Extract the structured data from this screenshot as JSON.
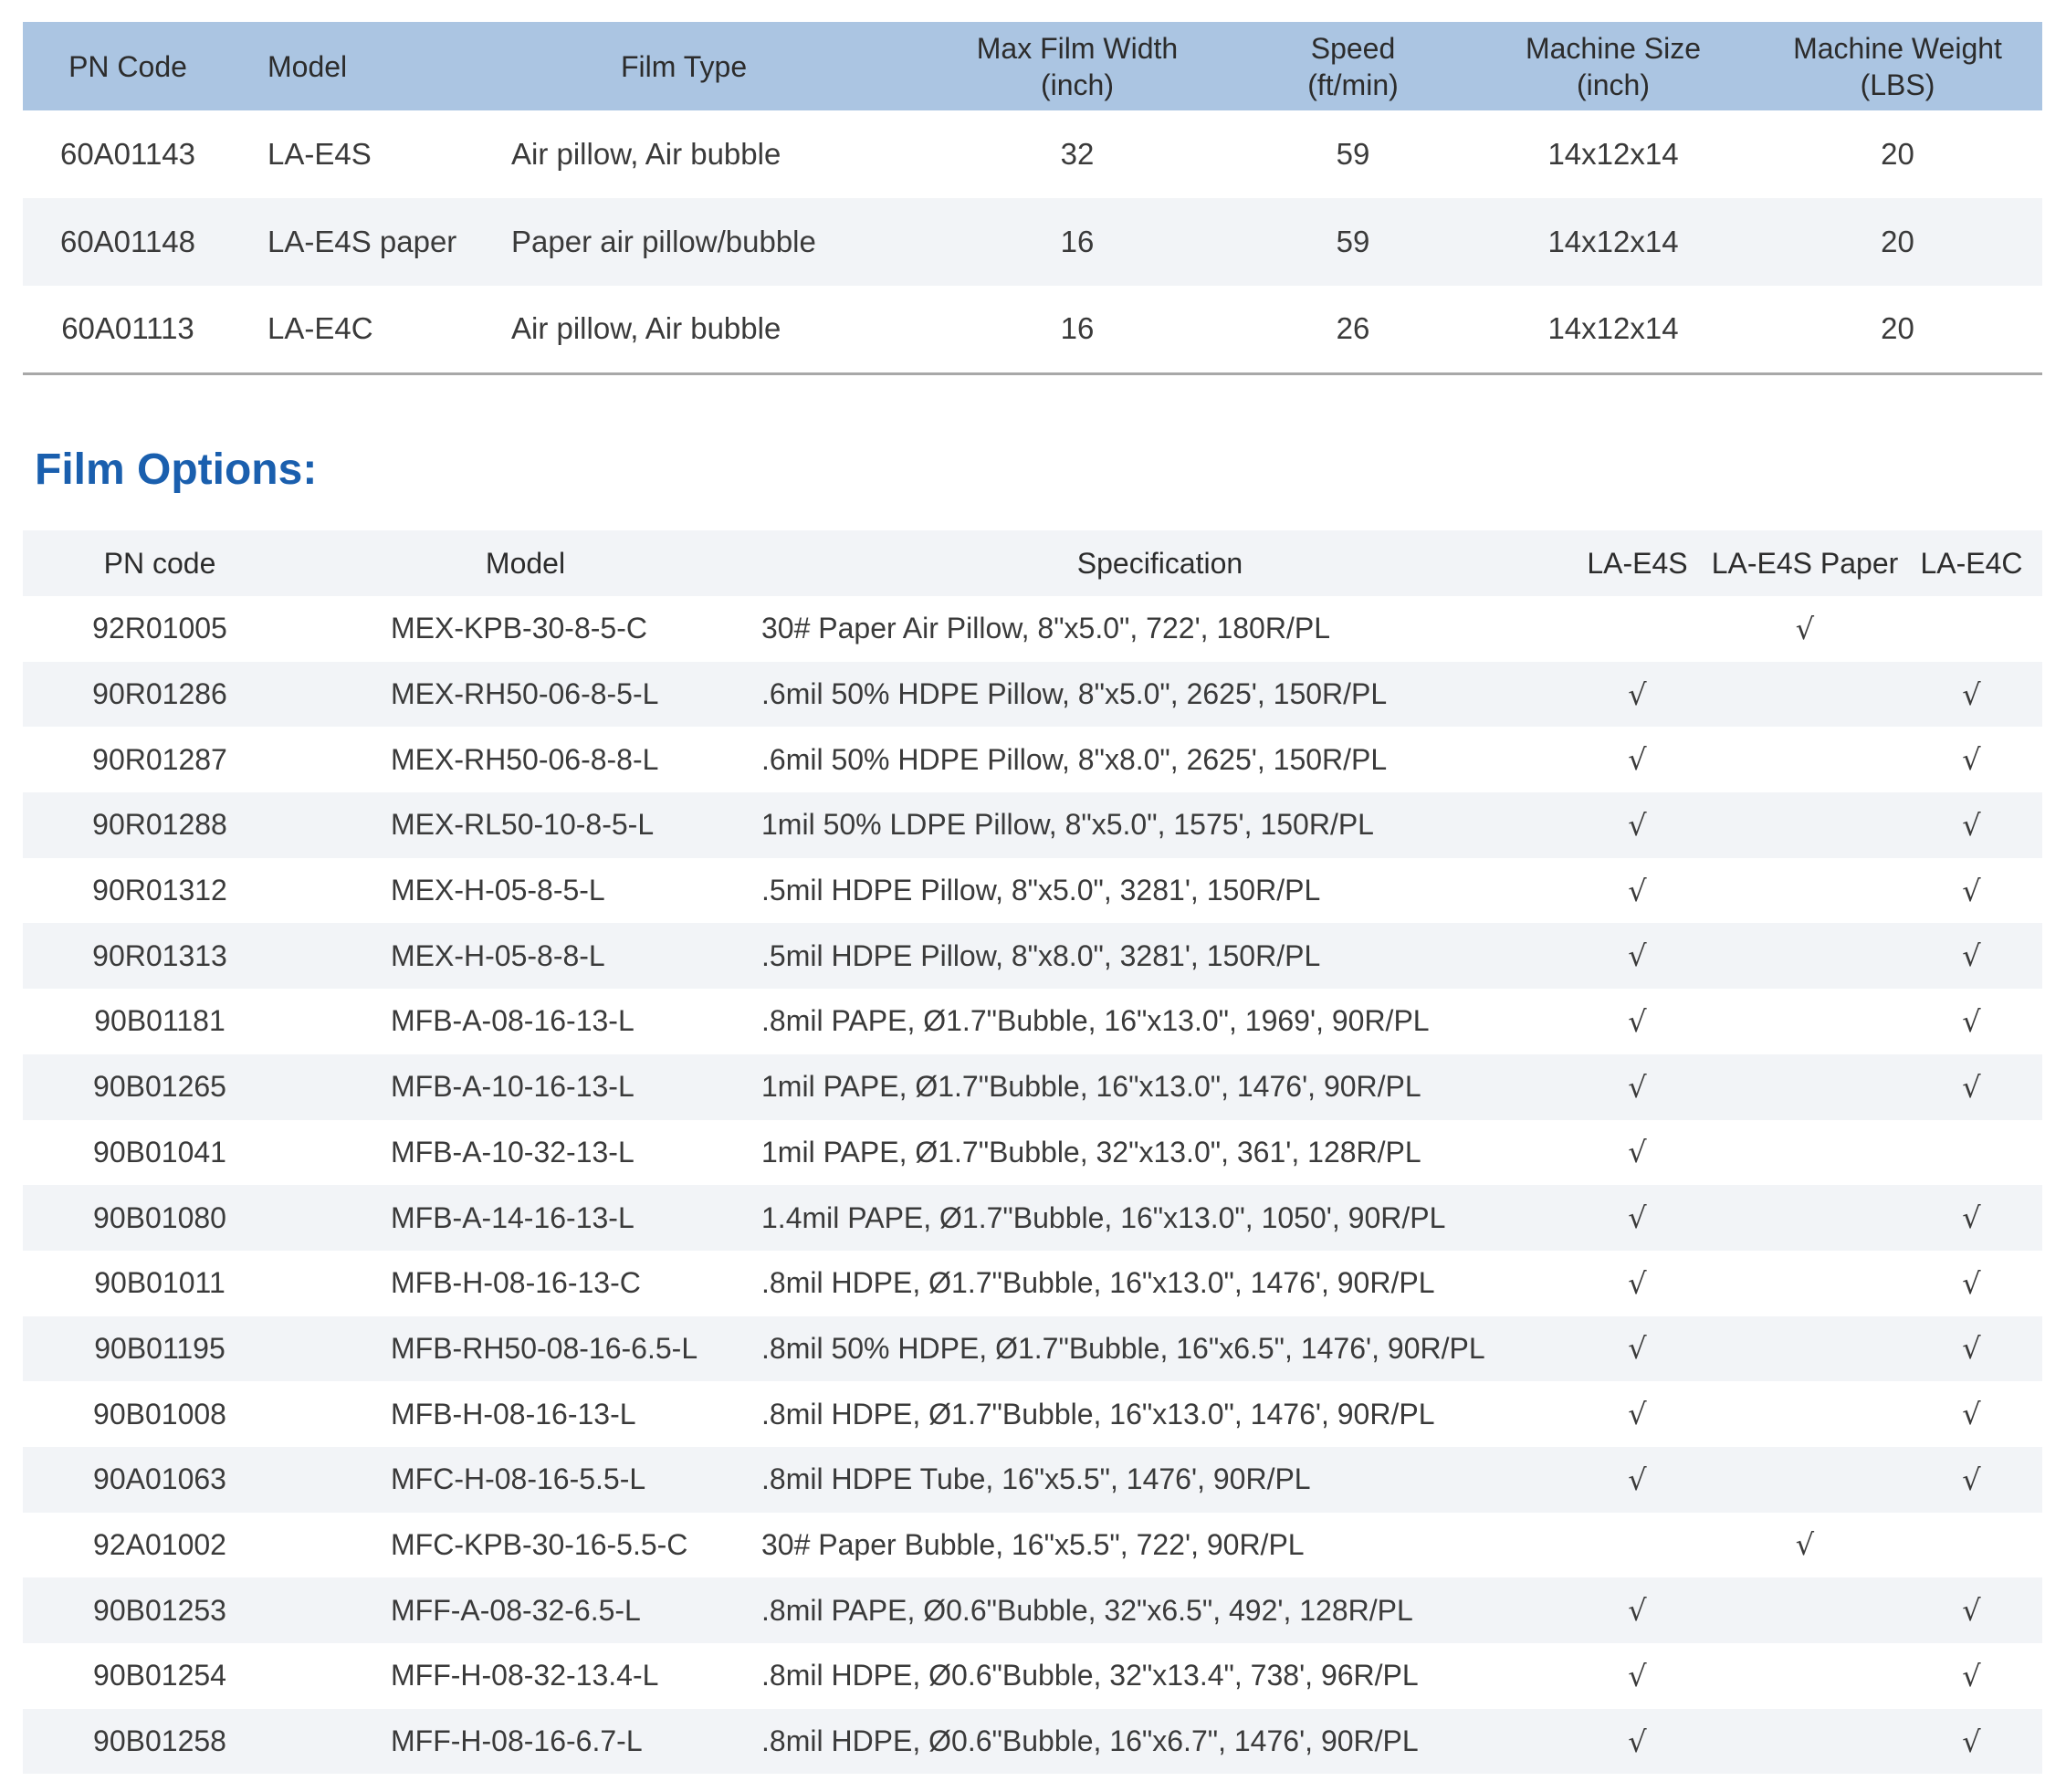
{
  "machine_table": {
    "headers": [
      {
        "line1": "PN Code",
        "line2": ""
      },
      {
        "line1": "Model",
        "line2": ""
      },
      {
        "line1": "Film Type",
        "line2": ""
      },
      {
        "line1": "Max Film Width",
        "line2": "(inch)"
      },
      {
        "line1": "Speed",
        "line2": "(ft/min)"
      },
      {
        "line1": "Machine Size",
        "line2": "(inch)"
      },
      {
        "line1": "Machine Weight",
        "line2": "(LBS)"
      }
    ],
    "rows": [
      [
        "60A01143",
        "LA-E4S",
        "Air pillow, Air bubble",
        "32",
        "59",
        "14x12x14",
        "20"
      ],
      [
        "60A01148",
        "LA-E4S paper",
        "Paper air pillow/bubble",
        "16",
        "59",
        "14x12x14",
        "20"
      ],
      [
        "60A01113",
        "LA-E4C",
        "Air pillow, Air bubble",
        "16",
        "26",
        "14x12x14",
        "20"
      ]
    ]
  },
  "film_options": {
    "title": "Film Options:",
    "headers": [
      "PN code",
      "Model",
      "Specification",
      "LA-E4S",
      "LA-E4S Paper",
      "LA-E4C"
    ],
    "check_mark": "√",
    "rows": [
      {
        "pn": "92R01005",
        "model": "MEX-KPB-30-8-5-C",
        "spec": "30# Paper Air Pillow, 8\"x5.0\", 722', 180R/PL",
        "e4s": "",
        "e4s_paper": "√",
        "e4c": ""
      },
      {
        "pn": "90R01286",
        "model": "MEX-RH50-06-8-5-L",
        "spec": ".6mil 50% HDPE Pillow, 8\"x5.0\", 2625', 150R/PL",
        "e4s": "√",
        "e4s_paper": "",
        "e4c": "√"
      },
      {
        "pn": "90R01287",
        "model": "MEX-RH50-06-8-8-L",
        "spec": ".6mil 50% HDPE Pillow, 8\"x8.0\", 2625', 150R/PL",
        "e4s": "√",
        "e4s_paper": "",
        "e4c": "√"
      },
      {
        "pn": "90R01288",
        "model": "MEX-RL50-10-8-5-L",
        "spec": "1mil 50% LDPE Pillow, 8\"x5.0\", 1575', 150R/PL",
        "e4s": "√",
        "e4s_paper": "",
        "e4c": "√"
      },
      {
        "pn": "90R01312",
        "model": "MEX-H-05-8-5-L",
        "spec": ".5mil HDPE Pillow, 8\"x5.0\", 3281', 150R/PL",
        "e4s": "√",
        "e4s_paper": "",
        "e4c": "√"
      },
      {
        "pn": "90R01313",
        "model": "MEX-H-05-8-8-L",
        "spec": ".5mil HDPE Pillow, 8\"x8.0\", 3281', 150R/PL",
        "e4s": "√",
        "e4s_paper": "",
        "e4c": "√"
      },
      {
        "pn": "90B01181",
        "model": "MFB-A-08-16-13-L",
        "spec": ".8mil PAPE, Ø1.7\"Bubble, 16\"x13.0\", 1969', 90R/PL",
        "e4s": "√",
        "e4s_paper": "",
        "e4c": "√"
      },
      {
        "pn": "90B01265",
        "model": "MFB-A-10-16-13-L",
        "spec": "1mil PAPE, Ø1.7\"Bubble, 16\"x13.0\", 1476', 90R/PL",
        "e4s": "√",
        "e4s_paper": "",
        "e4c": "√"
      },
      {
        "pn": "90B01041",
        "model": "MFB-A-10-32-13-L",
        "spec": "1mil PAPE, Ø1.7\"Bubble, 32\"x13.0\", 361', 128R/PL",
        "e4s": "√",
        "e4s_paper": "",
        "e4c": ""
      },
      {
        "pn": "90B01080",
        "model": "MFB-A-14-16-13-L",
        "spec": "1.4mil PAPE, Ø1.7\"Bubble, 16\"x13.0\", 1050', 90R/PL",
        "e4s": "√",
        "e4s_paper": "",
        "e4c": "√"
      },
      {
        "pn": "90B01011",
        "model": "MFB-H-08-16-13-C",
        "spec": ".8mil HDPE, Ø1.7\"Bubble, 16\"x13.0\", 1476', 90R/PL",
        "e4s": "√",
        "e4s_paper": "",
        "e4c": "√"
      },
      {
        "pn": "90B01195",
        "model": "MFB-RH50-08-16-6.5-L",
        "spec": ".8mil 50% HDPE, Ø1.7\"Bubble, 16\"x6.5\", 1476', 90R/PL",
        "e4s": "√",
        "e4s_paper": "",
        "e4c": "√"
      },
      {
        "pn": "90B01008",
        "model": "MFB-H-08-16-13-L",
        "spec": ".8mil HDPE, Ø1.7\"Bubble, 16\"x13.0\", 1476', 90R/PL",
        "e4s": "√",
        "e4s_paper": "",
        "e4c": "√"
      },
      {
        "pn": "90A01063",
        "model": "MFC-H-08-16-5.5-L",
        "spec": ".8mil HDPE Tube, 16\"x5.5\", 1476', 90R/PL",
        "e4s": "√",
        "e4s_paper": "",
        "e4c": "√"
      },
      {
        "pn": "92A01002",
        "model": "MFC-KPB-30-16-5.5-C",
        "spec": "30# Paper Bubble, 16\"x5.5\", 722', 90R/PL",
        "e4s": "",
        "e4s_paper": "√",
        "e4c": ""
      },
      {
        "pn": "90B01253",
        "model": "MFF-A-08-32-6.5-L",
        "spec": ".8mil PAPE, Ø0.6\"Bubble, 32\"x6.5\", 492', 128R/PL",
        "e4s": "√",
        "e4s_paper": "",
        "e4c": "√"
      },
      {
        "pn": "90B01254",
        "model": "MFF-H-08-32-13.4-L",
        "spec": ".8mil HDPE, Ø0.6\"Bubble, 32\"x13.4\", 738', 96R/PL",
        "e4s": "√",
        "e4s_paper": "",
        "e4c": "√"
      },
      {
        "pn": "90B01258",
        "model": "MFF-H-08-16-6.7-L",
        "spec": ".8mil HDPE, Ø0.6\"Bubble, 16\"x6.7\", 1476', 90R/PL",
        "e4s": "√",
        "e4s_paper": "",
        "e4c": "√"
      }
    ]
  }
}
